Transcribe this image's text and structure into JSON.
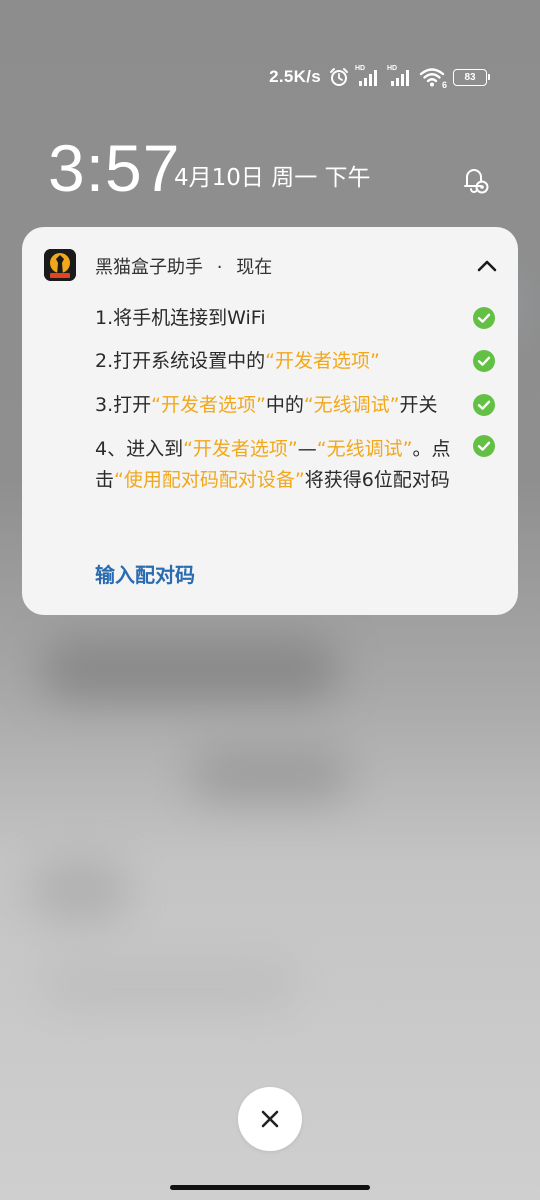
{
  "status_bar": {
    "net_speed": "2.5K/s",
    "signal_badges": [
      "HD",
      "HD"
    ],
    "wifi_badge": "6",
    "battery_level": "83",
    "icons": [
      "alarm-icon",
      "signal-icon",
      "signal-icon",
      "wifi-icon",
      "battery-icon"
    ]
  },
  "lockscreen": {
    "time": "3:57",
    "date": "4月10日 周一 下午"
  },
  "notification": {
    "app_name": "黑猫盒子助手",
    "separator": "·",
    "timestamp": "现在",
    "steps": [
      {
        "parts": [
          {
            "text": "1.将手机连接到WiFi",
            "highlight": false
          }
        ],
        "checked": true
      },
      {
        "parts": [
          {
            "text": "2.打开系统设置中的",
            "highlight": false
          },
          {
            "text": "“开发者选项”",
            "highlight": true
          }
        ],
        "checked": true
      },
      {
        "parts": [
          {
            "text": "3.打开",
            "highlight": false
          },
          {
            "text": "“开发者选项”",
            "highlight": true
          },
          {
            "text": "中的",
            "highlight": false
          },
          {
            "text": "“无线调试”",
            "highlight": true
          },
          {
            "text": "开关",
            "highlight": false
          }
        ],
        "checked": true
      },
      {
        "parts": [
          {
            "text": "4、进入到",
            "highlight": false
          },
          {
            "text": "“开发者选项”",
            "highlight": true
          },
          {
            "text": "—",
            "highlight": false
          },
          {
            "text": "“无线调试”",
            "highlight": true
          },
          {
            "text": "。点击",
            "highlight": false
          },
          {
            "text": "“使用配对码配对设备”",
            "highlight": true
          },
          {
            "text": "将获得6位配对码",
            "highlight": false
          }
        ],
        "checked": true
      }
    ],
    "action_label": "输入配对码"
  },
  "colors": {
    "highlight": "#f2a81b",
    "check": "#62c144",
    "link": "#2b6cb0"
  }
}
